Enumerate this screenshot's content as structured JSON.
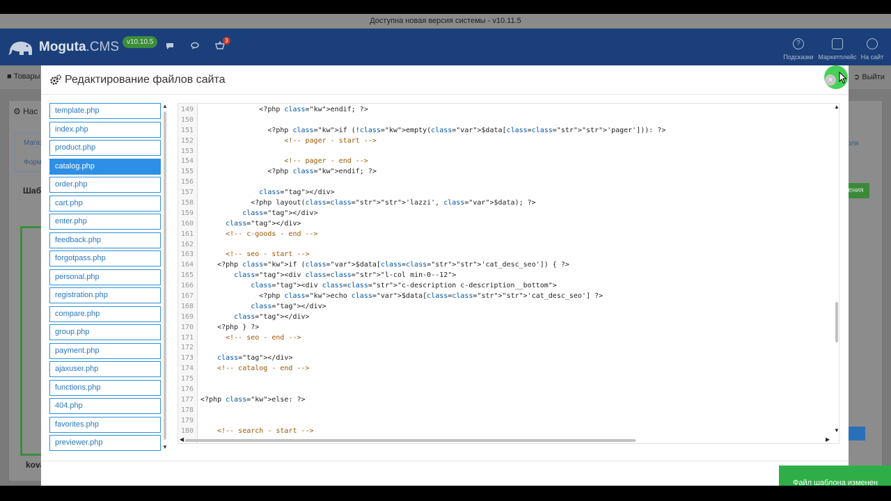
{
  "update_banner": "Доступна новая версия системы - v10.11.5",
  "header": {
    "logo_brand": "Moguta",
    "logo_suffix": ".CMS",
    "version": "v10.10.5",
    "cart_count": "3",
    "right_items": [
      {
        "label": "Подсказки",
        "icon": "question-icon"
      },
      {
        "label": "Маркетплейс",
        "icon": "shopping-bag-icon"
      },
      {
        "label": "На сайт",
        "icon": "globe-icon"
      }
    ]
  },
  "background": {
    "menu_left": "Товары",
    "menu_right": "Выйти",
    "card_tab_1": "Магаз",
    "card_tab_2": "Форм",
    "card_title": "Нас",
    "section_label": "Шабл",
    "right_link": "доля",
    "green_btn": "нения",
    "bottom_label": "kova"
  },
  "modal": {
    "title": "Редактирование файлов сайта",
    "close_glyph": "×",
    "files": [
      {
        "name": "template.php",
        "active": false
      },
      {
        "name": "index.php",
        "active": false
      },
      {
        "name": "product.php",
        "active": false
      },
      {
        "name": "catalog.php",
        "active": true
      },
      {
        "name": "order.php",
        "active": false
      },
      {
        "name": "cart.php",
        "active": false
      },
      {
        "name": "enter.php",
        "active": false
      },
      {
        "name": "feedback.php",
        "active": false
      },
      {
        "name": "forgotpass.php",
        "active": false
      },
      {
        "name": "personal.php",
        "active": false
      },
      {
        "name": "registration.php",
        "active": false
      },
      {
        "name": "compare.php",
        "active": false
      },
      {
        "name": "group.php",
        "active": false
      },
      {
        "name": "payment.php",
        "active": false
      },
      {
        "name": "ajaxuser.php",
        "active": false
      },
      {
        "name": "functions.php",
        "active": false
      },
      {
        "name": "404.php",
        "active": false
      },
      {
        "name": "favorites.php",
        "active": false
      },
      {
        "name": "previewer.php",
        "active": false
      }
    ],
    "code_lines": [
      {
        "n": "149",
        "t": "              <?php endif; ?>"
      },
      {
        "n": "150",
        "t": ""
      },
      {
        "n": "151",
        "t": "                <?php if (!empty($data['pager'])): ?>"
      },
      {
        "n": "152",
        "t": "                    <!-- pager - start -->"
      },
      {
        "n": "153",
        "t": ""
      },
      {
        "n": "154",
        "t": "                    <!-- pager - end -->"
      },
      {
        "n": "155",
        "t": "                <?php endif; ?>"
      },
      {
        "n": "156",
        "t": ""
      },
      {
        "n": "157",
        "t": "              </div>"
      },
      {
        "n": "158",
        "t": "            <?php layout('lazzi', $data); ?>"
      },
      {
        "n": "159",
        "t": "          </div>"
      },
      {
        "n": "160",
        "t": "      </div>"
      },
      {
        "n": "161",
        "t": "      <!-- c-goods - end -->"
      },
      {
        "n": "162",
        "t": ""
      },
      {
        "n": "163",
        "t": "      <!-- seo - start -->"
      },
      {
        "n": "164",
        "t": "    <?php if ($data['cat_desc_seo']) { ?>"
      },
      {
        "n": "165",
        "t": "        <div class=\"l-col min-0--12\">"
      },
      {
        "n": "166",
        "t": "            <div class=\"c-description c-description__bottom\">"
      },
      {
        "n": "167",
        "t": "              <?php echo $data['cat_desc_seo'] ?>"
      },
      {
        "n": "168",
        "t": "            </div>"
      },
      {
        "n": "169",
        "t": "        </div>"
      },
      {
        "n": "170",
        "t": "    <?php } ?>"
      },
      {
        "n": "171",
        "t": "      <!-- seo - end -->"
      },
      {
        "n": "172",
        "t": ""
      },
      {
        "n": "173",
        "t": "    </div>"
      },
      {
        "n": "174",
        "t": "    <!-- catalog - end -->"
      },
      {
        "n": "175",
        "t": ""
      },
      {
        "n": "176",
        "t": ""
      },
      {
        "n": "177",
        "t": "<?php else: ?>"
      },
      {
        "n": "178",
        "t": ""
      },
      {
        "n": "179",
        "t": ""
      },
      {
        "n": "180",
        "t": "    <!-- search - start -->"
      }
    ]
  },
  "toast": "Файл шаблона изменен"
}
